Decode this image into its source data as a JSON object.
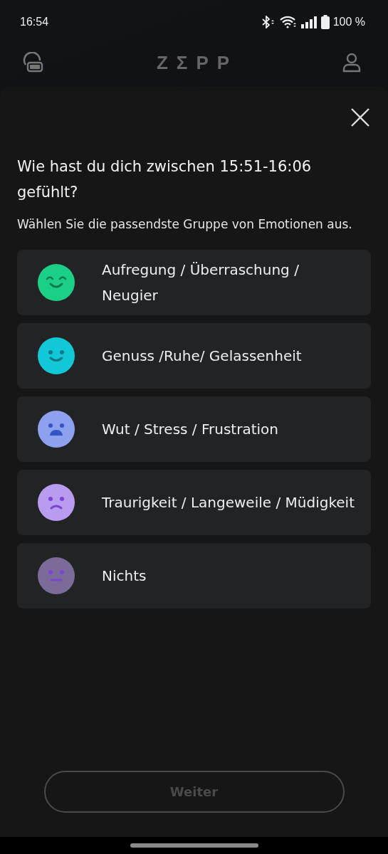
{
  "status_bar": {
    "time": "16:54",
    "battery": "100 %"
  },
  "header": {
    "logo": "ZΣPP"
  },
  "sheet": {
    "question": "Wie hast du dich zwischen 15:51-16:06 gefühlt?",
    "instruction": "Wählen Sie die passendste Gruppe von Emotionen aus.",
    "options": [
      {
        "label": "Aufregung / Überraschung / Neugier",
        "kind": "beaming",
        "color": "#1ccf86",
        "selected": false
      },
      {
        "label": "Genuss /Ruhe/ Gelassenheit",
        "kind": "smile",
        "color": "#12c7d8",
        "selected": false
      },
      {
        "label": "Wut / Stress / Frustration",
        "kind": "worried",
        "color": "#8ea1ee",
        "selected": false
      },
      {
        "label": "Traurigkeit / Langeweile / Müdigkeit",
        "kind": "sad",
        "color": "#b99cef",
        "selected": false
      },
      {
        "label": "Nichts",
        "kind": "neutral",
        "color": "#7b6b98",
        "selected": false
      }
    ],
    "next_button": {
      "label": "Weiter",
      "disabled": true
    }
  }
}
